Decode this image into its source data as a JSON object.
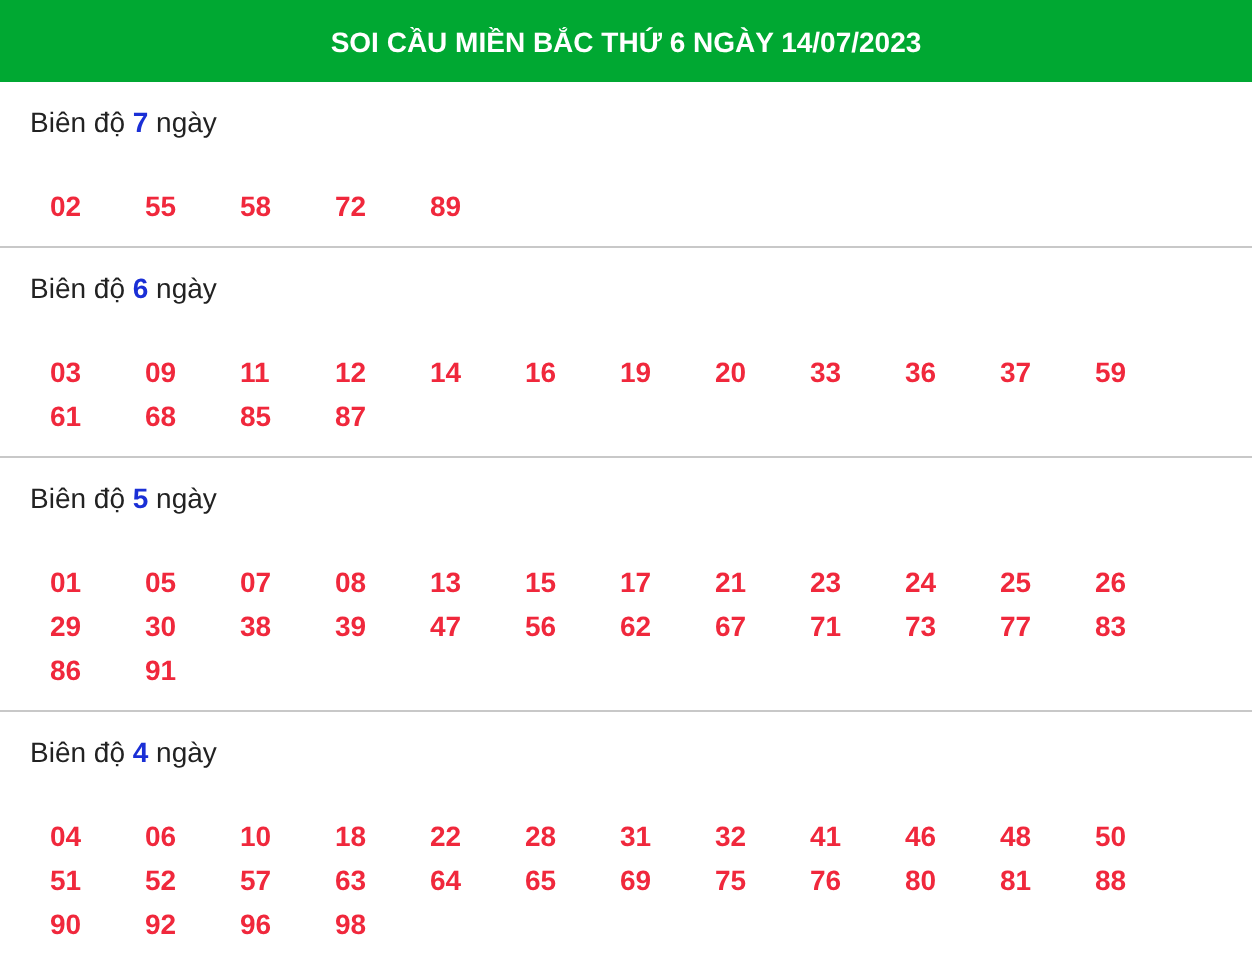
{
  "header": {
    "title": "SOI CẦU MIỀN BẮC THỨ 6 NGÀY 14/07/2023"
  },
  "sections": [
    {
      "heading": "Biên độ **7** ngày",
      "numbers": [
        "02",
        "55",
        "58",
        "72",
        "89"
      ]
    },
    {
      "heading": "Biên độ **6** ngày",
      "numbers": [
        "03",
        "09",
        "11",
        "12",
        "14",
        "16",
        "19",
        "20",
        "33",
        "36",
        "37",
        "59",
        "61",
        "68",
        "85",
        "87"
      ]
    },
    {
      "heading": "Biên độ **5** ngày",
      "numbers": [
        "01",
        "05",
        "07",
        "08",
        "13",
        "15",
        "17",
        "21",
        "23",
        "24",
        "25",
        "26",
        "29",
        "30",
        "38",
        "39",
        "47",
        "56",
        "62",
        "67",
        "71",
        "73",
        "77",
        "83",
        "86",
        "91"
      ]
    },
    {
      "heading": "Biên độ **4** ngày",
      "numbers": [
        "04",
        "06",
        "10",
        "18",
        "22",
        "28",
        "31",
        "32",
        "41",
        "46",
        "48",
        "50",
        "51",
        "52",
        "57",
        "63",
        "64",
        "65",
        "69",
        "75",
        "76",
        "80",
        "81",
        "88",
        "90",
        "92",
        "96",
        "98"
      ]
    }
  ]
}
